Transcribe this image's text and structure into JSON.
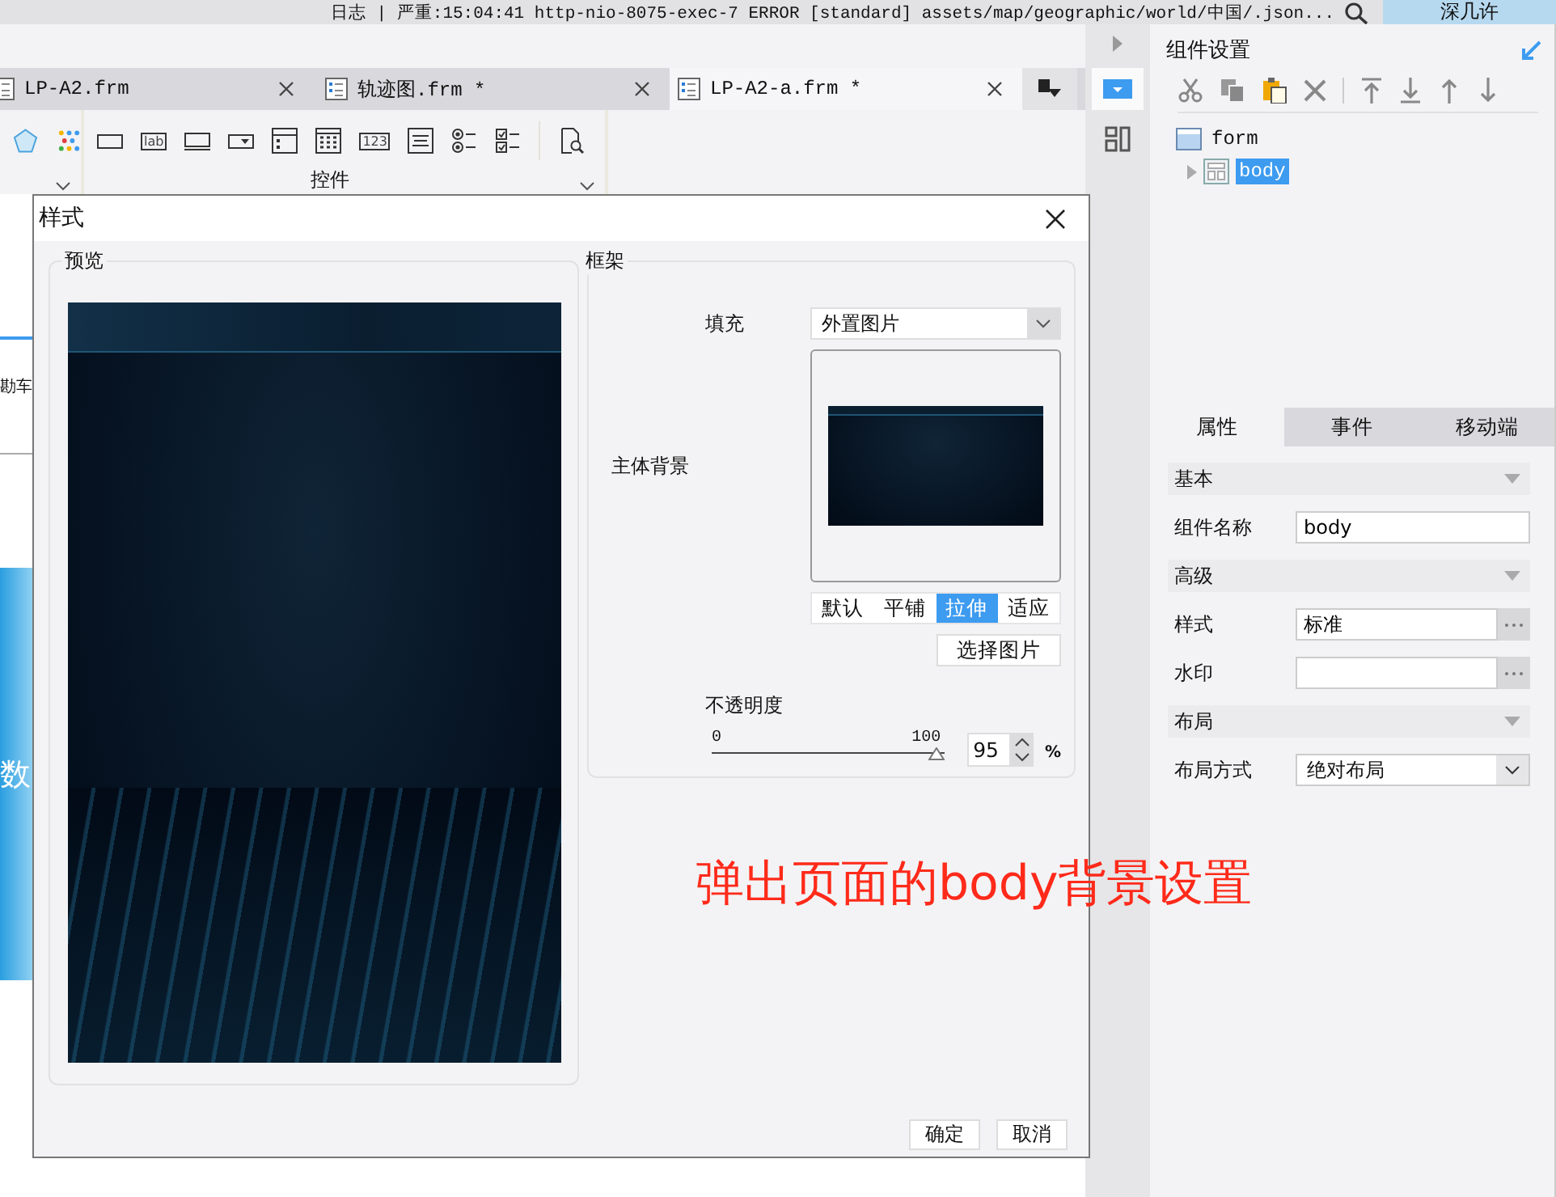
{
  "top_bar": {
    "log_text": "日志 | 严重:15:04:41 http-nio-8075-exec-7 ERROR [standard] assets/map/geographic/world/中国/.json...",
    "user_button": "深几许"
  },
  "file_tabs": [
    {
      "label": "LP-A2.frm",
      "selected": false
    },
    {
      "label": "轨迹图.frm *",
      "selected": false
    },
    {
      "label": "LP-A2-a.frm *",
      "selected": true
    }
  ],
  "toolbar": {
    "group_label": "控件",
    "widgets": [
      {
        "kind": "textbox"
      },
      {
        "kind": "label",
        "text": "lab"
      },
      {
        "kind": "button"
      },
      {
        "kind": "dropdown"
      },
      {
        "kind": "panel"
      },
      {
        "kind": "calendar"
      },
      {
        "kind": "number",
        "text": "123"
      },
      {
        "kind": "textarea"
      },
      {
        "kind": "radio"
      },
      {
        "kind": "checkbox"
      },
      {
        "kind": "preview"
      }
    ]
  },
  "canvas": {
    "fragments": [
      "勘车",
      "数"
    ]
  },
  "dialog": {
    "title": "样式",
    "preview_legend": "预览",
    "frame_legend": "框架",
    "fill_label": "填充",
    "fill_value": "外置图片",
    "body_bg_label": "主体背景",
    "modes": [
      {
        "label": "默认",
        "selected": false
      },
      {
        "label": "平铺",
        "selected": false
      },
      {
        "label": "拉伸",
        "selected": true
      },
      {
        "label": "适应",
        "selected": false
      }
    ],
    "choose_button": "选择图片",
    "opacity_label": "不透明度",
    "opacity": {
      "min_label": "0",
      "max_label": "100",
      "level": 0.97,
      "value": "95",
      "unit": "%"
    },
    "buttons": [
      "确定",
      "取消"
    ]
  },
  "side_panel": {
    "title": "组件设置",
    "tree": [
      {
        "label": "form",
        "selected": false,
        "children": [
          {
            "label": "body",
            "selected": true,
            "expanded": false
          }
        ]
      }
    ],
    "tabs": [
      {
        "label": "属性",
        "selected": true
      },
      {
        "label": "事件",
        "selected": false
      },
      {
        "label": "移动端",
        "selected": false
      }
    ],
    "groups": [
      {
        "title": "基本",
        "rows": [
          {
            "label": "组件名称",
            "kind": "text",
            "value": "body"
          }
        ]
      },
      {
        "title": "高级",
        "rows": [
          {
            "label": "样式",
            "kind": "picker",
            "value": "标准"
          },
          {
            "label": "水印",
            "kind": "picker"
          }
        ]
      },
      {
        "title": "布局",
        "rows": [
          {
            "label": "布局方式",
            "kind": "select",
            "value": "绝对布局"
          }
        ]
      }
    ]
  },
  "annotation": "弹出页面的body背景设置"
}
